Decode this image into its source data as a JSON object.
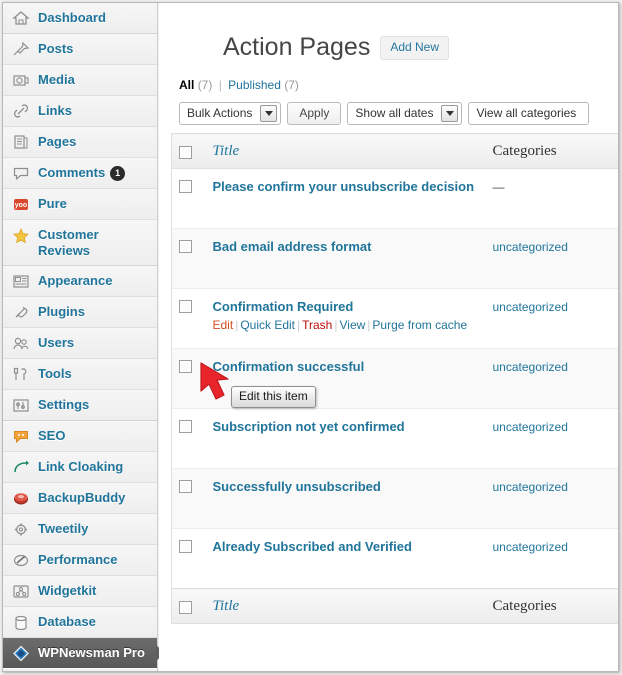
{
  "sidebar": {
    "groups": [
      {
        "items": [
          {
            "label": "Dashboard",
            "icon": "home-icon",
            "active": false
          }
        ]
      },
      {
        "items": [
          {
            "label": "Posts",
            "icon": "pin-icon",
            "active": false
          },
          {
            "label": "Media",
            "icon": "camera-icon",
            "active": false
          },
          {
            "label": "Links",
            "icon": "link-icon",
            "active": false
          },
          {
            "label": "Pages",
            "icon": "page-icon",
            "active": false
          },
          {
            "label": "Comments",
            "icon": "comment-icon",
            "badge": "1",
            "active": false
          },
          {
            "label": "Pure",
            "icon": "yoo-icon",
            "active": false
          },
          {
            "label": "Customer Reviews",
            "icon": "star-icon",
            "active": false
          }
        ]
      },
      {
        "items": [
          {
            "label": "Appearance",
            "icon": "appearance-icon",
            "active": false
          },
          {
            "label": "Plugins",
            "icon": "plug-icon",
            "active": false
          },
          {
            "label": "Users",
            "icon": "users-icon",
            "active": false
          },
          {
            "label": "Tools",
            "icon": "tools-icon",
            "active": false
          },
          {
            "label": "Settings",
            "icon": "settings-icon",
            "active": false
          }
        ]
      },
      {
        "items": [
          {
            "label": "SEO",
            "icon": "seo-icon",
            "active": false
          },
          {
            "label": "Link Cloaking",
            "icon": "arrow-curve-icon",
            "active": false
          },
          {
            "label": "BackupBuddy",
            "icon": "backup-icon",
            "active": false
          },
          {
            "label": "Tweetily",
            "icon": "gear-icon",
            "active": false
          },
          {
            "label": "Performance",
            "icon": "performance-icon",
            "active": false
          },
          {
            "label": "Widgetkit",
            "icon": "widgetkit-icon",
            "active": false
          },
          {
            "label": "Database",
            "icon": "database-icon",
            "active": false
          },
          {
            "label": "WPNewsman Pro",
            "icon": "diamond-icon",
            "active": true
          }
        ]
      }
    ]
  },
  "header": {
    "title": "Action Pages",
    "add_new_label": "Add New"
  },
  "views": {
    "all_label": "All",
    "all_count": "(7)",
    "separator": "|",
    "published_label": "Published",
    "published_count": "(7)"
  },
  "tablenav": {
    "bulk_actions_label": "Bulk Actions",
    "apply_label": "Apply",
    "show_all_dates_label": "Show all dates",
    "view_all_categories_label": "View all categories"
  },
  "table": {
    "columns": {
      "title": "Title",
      "categories": "Categories"
    },
    "rows": [
      {
        "title": "Please confirm your unsubscribe decision",
        "category": "—",
        "category_is_dash": true,
        "show_actions": false
      },
      {
        "title": "Bad email address format",
        "category": "uncategorized",
        "category_is_dash": false,
        "show_actions": false
      },
      {
        "title": "Confirmation Required",
        "category": "uncategorized",
        "category_is_dash": false,
        "show_actions": true
      },
      {
        "title": "Confirmation successful",
        "category": "uncategorized",
        "category_is_dash": false,
        "show_actions": false
      },
      {
        "title": "Subscription not yet confirmed",
        "category": "uncategorized",
        "category_is_dash": false,
        "show_actions": false
      },
      {
        "title": "Successfully unsubscribed",
        "category": "uncategorized",
        "category_is_dash": false,
        "show_actions": false
      },
      {
        "title": "Already Subscribed and Verified",
        "category": "uncategorized",
        "category_is_dash": false,
        "show_actions": false
      }
    ],
    "row_actions": {
      "edit": "Edit",
      "quick_edit": "Quick Edit",
      "trash": "Trash",
      "view": "View",
      "purge": "Purge from cache",
      "separator": "|"
    }
  },
  "tooltip": {
    "text": "Edit this item"
  },
  "colors": {
    "link": "#21759b",
    "edit_hover": "#d54e21",
    "trash": "#bc0b0b",
    "cursor": "#e8252a",
    "active_menu_bg": "#5e5e5e"
  }
}
